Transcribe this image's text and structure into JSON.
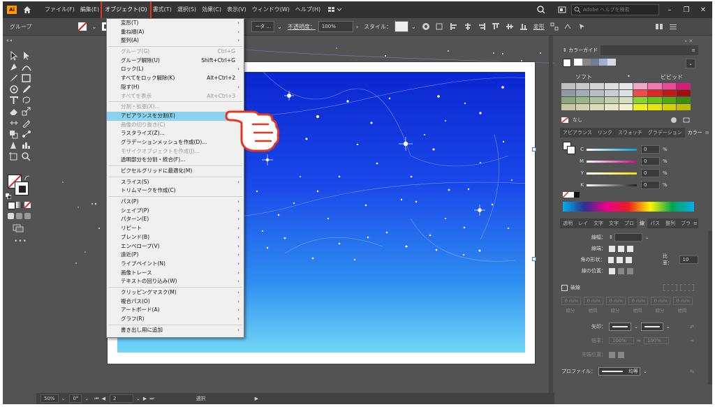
{
  "menubar": {
    "logo": "Ai",
    "items": [
      "ファイル(F)",
      "編集(E)",
      "オブジェクト(O)",
      "書式(T)",
      "選択(S)",
      "効果(C)",
      "表示(V)",
      "ウィンドウ(W)",
      "ヘルプ(H)"
    ],
    "active_index": 2,
    "help_search_placeholder": "Adobe ヘルプを検索"
  },
  "controlbar": {
    "selection_label": "グループ",
    "style_partial": "ータ ...",
    "opacity_label": "不透明度：",
    "opacity_value": "100%",
    "style_label": "スタイル：",
    "transform_label": "変形"
  },
  "object_menu": {
    "items": [
      {
        "label": "変形(T)",
        "submenu": true,
        "disabled": false
      },
      {
        "label": "重ね順(A)",
        "submenu": true,
        "disabled": false
      },
      {
        "label": "整列(A)",
        "submenu": true,
        "disabled": false
      },
      {
        "separator": true
      },
      {
        "label": "グループ(G)",
        "shortcut": "Ctrl+G",
        "disabled": true
      },
      {
        "label": "グループ解除(U)",
        "shortcut": "Shift+Ctrl+G",
        "disabled": false
      },
      {
        "label": "ロック(L)",
        "submenu": true,
        "disabled": false
      },
      {
        "label": "すべてをロック解除(K)",
        "shortcut": "Alt+Ctrl+2",
        "disabled": false
      },
      {
        "label": "隠す(H)",
        "submenu": true,
        "disabled": false
      },
      {
        "label": "すべてを表示",
        "shortcut": "Alt+Ctrl+3",
        "disabled": true
      },
      {
        "separator": true
      },
      {
        "label": "分割・拡張(X)...",
        "disabled": true
      },
      {
        "label": "アピアランスを分割(E)",
        "disabled": false,
        "highlight": true
      },
      {
        "label": "画像の切り抜き(C)",
        "disabled": true
      },
      {
        "label": "ラスタライズ(Z)...",
        "disabled": false
      },
      {
        "label": "グラデーションメッシュを作成(D)...",
        "disabled": false
      },
      {
        "label": "モザイクオブジェクトを作成(J)...",
        "disabled": true
      },
      {
        "label": "透明部分を分割・統合(F)...",
        "disabled": false
      },
      {
        "separator": true
      },
      {
        "label": "ピクセルグリッドに最適化(M)",
        "disabled": false
      },
      {
        "separator": true
      },
      {
        "label": "スライス(S)",
        "submenu": true,
        "disabled": false
      },
      {
        "label": "トリムマークを作成(C)",
        "disabled": false
      },
      {
        "separator": true
      },
      {
        "label": "パス(P)",
        "submenu": true,
        "disabled": false
      },
      {
        "label": "シェイプ(P)",
        "submenu": true,
        "disabled": false
      },
      {
        "label": "パターン(E)",
        "submenu": true,
        "disabled": false
      },
      {
        "label": "リピート",
        "submenu": true,
        "disabled": false
      },
      {
        "label": "ブレンド(B)",
        "submenu": true,
        "disabled": false
      },
      {
        "label": "エンベロープ(V)",
        "submenu": true,
        "disabled": false
      },
      {
        "label": "遠近(P)",
        "submenu": true,
        "disabled": false
      },
      {
        "label": "ライブペイント(N)",
        "submenu": true,
        "disabled": false
      },
      {
        "label": "画像トレース",
        "submenu": true,
        "disabled": false
      },
      {
        "label": "テキストの回り込み(W)",
        "submenu": true,
        "disabled": false
      },
      {
        "separator": true
      },
      {
        "label": "クリッピングマスク(M)",
        "submenu": true,
        "disabled": false
      },
      {
        "label": "複合パス(O)",
        "submenu": true,
        "disabled": false
      },
      {
        "label": "アートボード(A)",
        "submenu": true,
        "disabled": false
      },
      {
        "label": "グラフ(R)",
        "submenu": true,
        "disabled": false
      },
      {
        "separator": true
      },
      {
        "label": "書き出し用に追加",
        "submenu": true,
        "disabled": false
      }
    ]
  },
  "color_guide": {
    "tab": "カラーガイド",
    "soft_label": "ソフト",
    "vivid_label": "ビビッド",
    "none_label": "なし",
    "swatch_rows": [
      [
        "#bfbfbf",
        "#c9c9c9",
        "#d4d4d4",
        "#dedede",
        "#e8e8e8",
        "#f2a6c8",
        "#f07ab2",
        "#e84a98",
        "#d81a7a"
      ],
      [
        "#8f9aa3",
        "#a2acb4",
        "#b5bec4",
        "#c8cfd4",
        "#dbe0e3",
        "#f04a4a",
        "#e02828",
        "#c01818",
        "#a01010"
      ],
      [
        "#8ea47a",
        "#9fb38b",
        "#b0c29d",
        "#c1d1ae",
        "#d2e0c0",
        "#8ad430",
        "#6cc21a",
        "#52a814",
        "#3a8c0e"
      ],
      [
        "#c8c8a0",
        "#d2d2ac",
        "#dcdcb8",
        "#e6e6c4",
        "#f0f0d0",
        "#f0f01e",
        "#e6e60a",
        "#d2d200",
        "#bebe00"
      ]
    ],
    "color_bar": [
      "#ffffff",
      "#101010",
      "#d0d8e0",
      "#a0b0c0",
      "#6080a0"
    ]
  },
  "color_panel": {
    "tabs": [
      "アピアランス",
      "リンク",
      "スウォッチ",
      "グラデーション",
      "カラー"
    ],
    "active_tab": "カラー",
    "sliders": [
      {
        "label": "C",
        "value": "0",
        "unit": "%",
        "color": "#00a0e0"
      },
      {
        "label": "M",
        "value": "0",
        "unit": "%",
        "color": "#e0008c"
      },
      {
        "label": "Y",
        "value": "0",
        "unit": "%",
        "color": "#f0e000"
      },
      {
        "label": "K",
        "value": "0",
        "unit": "%",
        "color": "#202020"
      }
    ]
  },
  "stroke_panel": {
    "tabs": [
      "透明",
      "レイ",
      "文字",
      "文字",
      "プロ",
      "線",
      "パス",
      "整列",
      "ブラ"
    ],
    "active_tab": "線",
    "weight_label": "線幅：",
    "cap_label": "線端：",
    "corner_label": "角の形状：",
    "miter_label": "比率：",
    "miter_value": "10",
    "align_label": "線の位置：",
    "dashed_label": "破線",
    "dash_labels": [
      "0 mm",
      "0 mm",
      "0 mm",
      "0 mm",
      "0 mm",
      "0 mm"
    ],
    "dash_sub_labels": [
      "線分",
      "間隔",
      "線分",
      "間隔",
      "線分",
      "間隔"
    ],
    "arrow_label": "矢印：",
    "scale_label": "倍率：",
    "scale_values": [
      "100%",
      "100%"
    ],
    "align_arrow_label": "先端位置：",
    "profile_label": "プロファイル：",
    "profile_value": "均等"
  },
  "statusbar": {
    "zoom": "50%",
    "rotate": "0°",
    "artboard": "2",
    "tool": "選択"
  }
}
